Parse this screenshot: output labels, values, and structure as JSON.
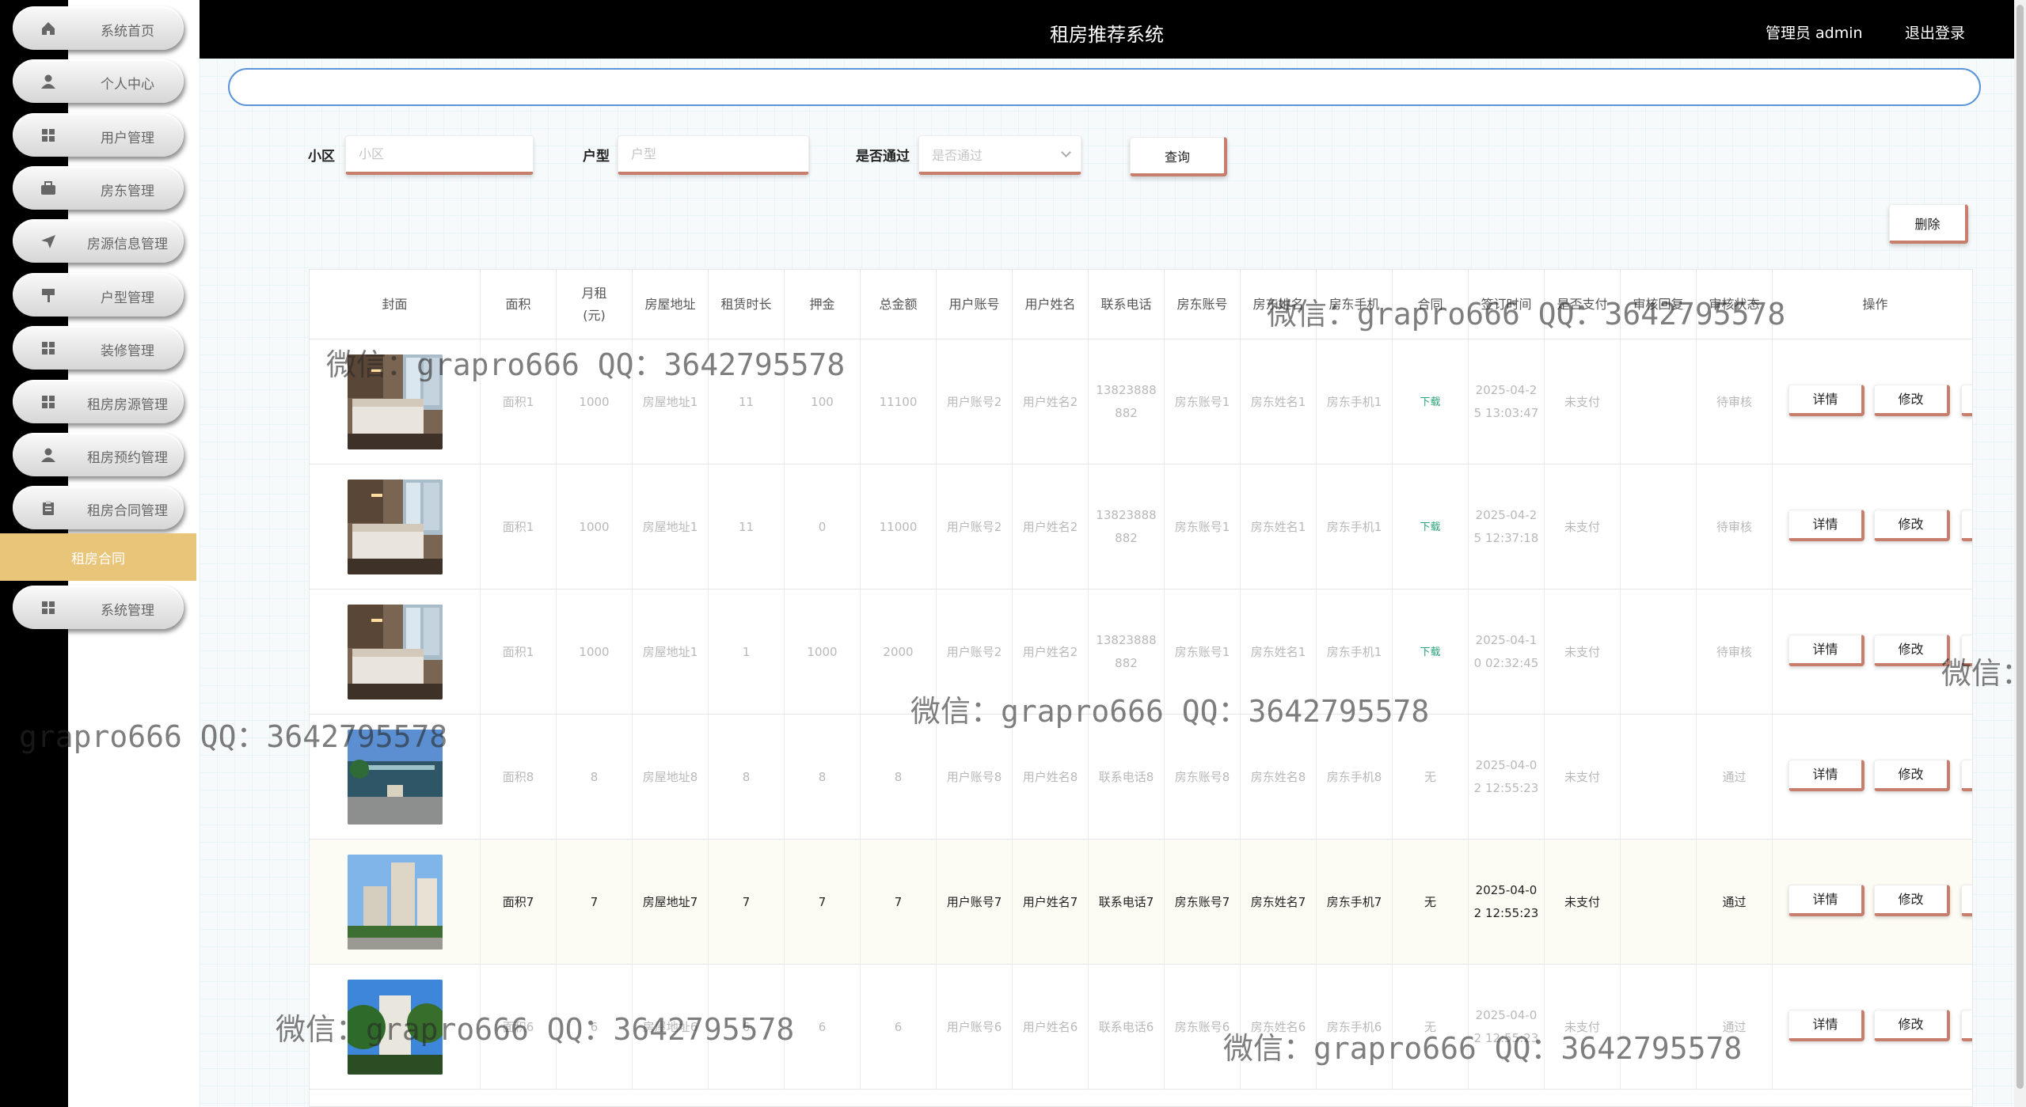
{
  "header": {
    "title": "租房推荐系统",
    "admin": "管理员 admin",
    "logout": "退出登录"
  },
  "sidebar": {
    "items": [
      {
        "label": "系统首页",
        "icon": "home-icon"
      },
      {
        "label": "个人中心",
        "icon": "user-icon"
      },
      {
        "label": "用户管理",
        "icon": "grid-icon"
      },
      {
        "label": "房东管理",
        "icon": "briefcase-icon"
      },
      {
        "label": "房源信息管理",
        "icon": "send-icon"
      },
      {
        "label": "户型管理",
        "icon": "sign-icon"
      },
      {
        "label": "装修管理",
        "icon": "grid-icon"
      },
      {
        "label": "租房房源管理",
        "icon": "grid-icon"
      },
      {
        "label": "租房预约管理",
        "icon": "user-icon"
      },
      {
        "label": "租房合同管理",
        "icon": "clipboard-icon"
      }
    ],
    "sub_item": "租房合同",
    "last_item": {
      "label": "系统管理",
      "icon": "grid-icon"
    }
  },
  "filters": {
    "community_label": "小区",
    "community_placeholder": "小区",
    "layout_label": "户型",
    "layout_placeholder": "户型",
    "approved_label": "是否通过",
    "approved_placeholder": "是否通过",
    "search_button": "查询",
    "delete_button": "删除"
  },
  "table": {
    "headers": [
      "封面",
      "面积",
      "月租\n(元)",
      "房屋地址",
      "租赁时长",
      "押金",
      "总金额",
      "用户账号",
      "用户姓名",
      "联系电话",
      "房东账号",
      "房东姓名",
      "房东手机",
      "合同",
      "签订时间",
      "是否支付",
      "审核回复",
      "审核状态",
      "操作"
    ],
    "detail_label": "详情",
    "edit_label": "修改",
    "rows": [
      {
        "cover": "bedroom",
        "cells": [
          "面积1",
          "1000",
          "房屋地址1",
          "11",
          "100",
          "11100",
          "用户账号2",
          "用户姓名2",
          "13823888882",
          "房东账号1",
          "房东姓名1",
          "房东手机1",
          "下载",
          "2025-04-25 13:03:47",
          "未支付",
          "",
          "待审核"
        ]
      },
      {
        "cover": "bedroom",
        "cells": [
          "面积1",
          "1000",
          "房屋地址1",
          "11",
          "0",
          "11000",
          "用户账号2",
          "用户姓名2",
          "13823888882",
          "房东账号1",
          "房东姓名1",
          "房东手机1",
          "下载",
          "2025-04-25 12:37:18",
          "未支付",
          "",
          "待审核"
        ]
      },
      {
        "cover": "bedroom",
        "cells": [
          "面积1",
          "1000",
          "房屋地址1",
          "1",
          "1000",
          "2000",
          "用户账号2",
          "用户姓名2",
          "13823888882",
          "房东账号1",
          "房东姓名1",
          "房东手机1",
          "下载",
          "2025-04-10 02:32:45",
          "未支付",
          "",
          "待审核"
        ]
      },
      {
        "cover": "building",
        "cells": [
          "面积8",
          "8",
          "房屋地址8",
          "8",
          "8",
          "8",
          "用户账号8",
          "用户姓名8",
          "联系电话8",
          "房东账号8",
          "房东姓名8",
          "房东手机8",
          "无",
          "2025-04-02 12:55:23",
          "未支付",
          "",
          "通过"
        ]
      },
      {
        "cover": "tower",
        "cells": [
          "面积7",
          "7",
          "房屋地址7",
          "7",
          "7",
          "7",
          "用户账号7",
          "用户姓名7",
          "联系电话7",
          "房东账号7",
          "房东姓名7",
          "房东手机7",
          "无",
          "2025-04-02 12:55:23",
          "未支付",
          "",
          "通过"
        ]
      },
      {
        "cover": "palm",
        "cells": [
          "面积6",
          "6",
          "房屋地址6",
          "6",
          "6",
          "6",
          "用户账号6",
          "用户姓名6",
          "联系电话6",
          "房东账号6",
          "房东姓名6",
          "房东手机6",
          "无",
          "2025-04-02 12:55:23",
          "未支付",
          "",
          "通过"
        ]
      }
    ]
  },
  "watermarks": [
    "微信：grapro666 QQ：3642795578",
    "微信：grapro666 QQ：3642795578",
    "微信：grapro666 QQ：3642795578",
    "grapro666 QQ：3642795578",
    "微信：grapro666 QQ：3642795578",
    "微信：grapro666 QQ：3642795578",
    "微信："
  ],
  "colors": {
    "accent_border": "#c77e6c",
    "sidebar_active": "#e8c579",
    "header_bg": "#000000",
    "download_link": "#2aa57a"
  }
}
